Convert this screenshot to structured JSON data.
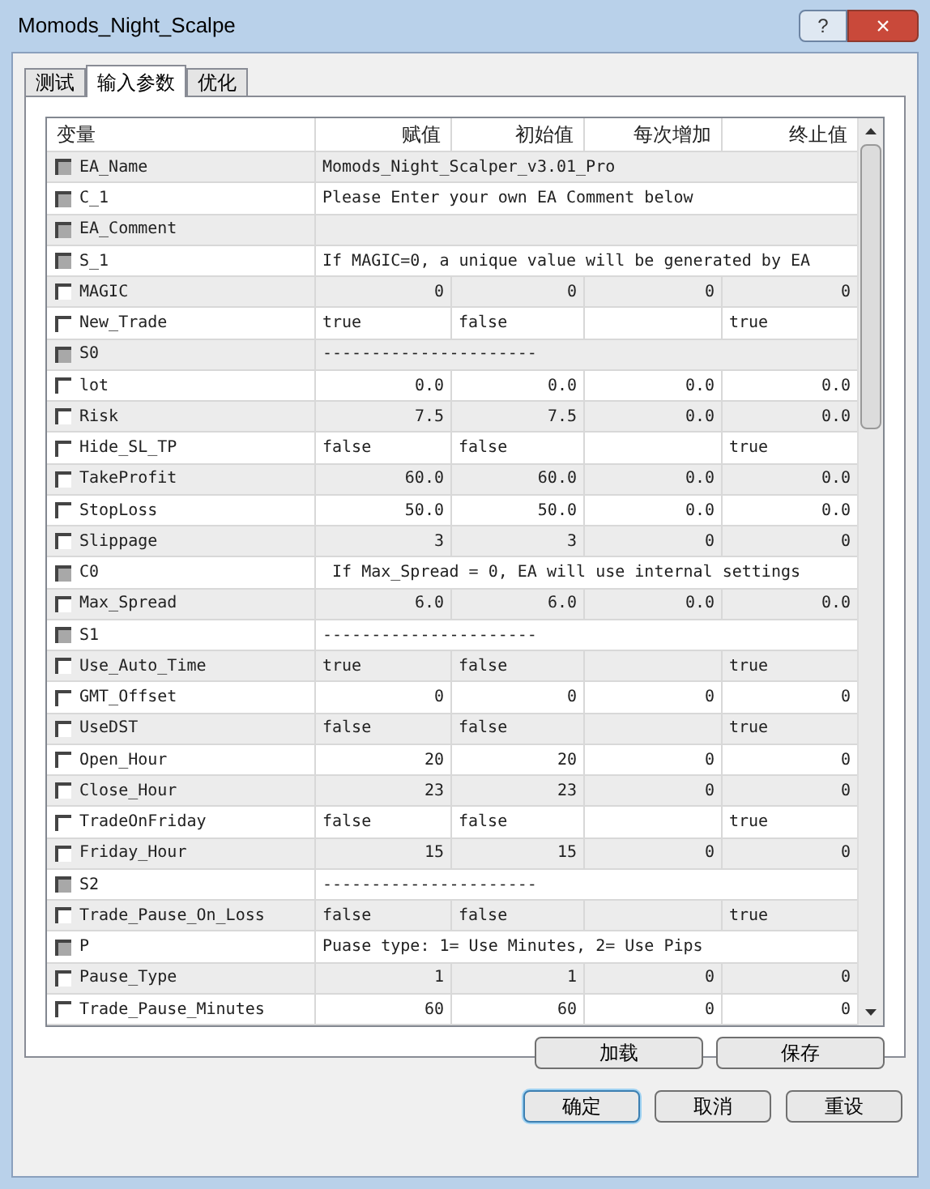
{
  "window": {
    "title": "Momods_Night_Scalpe",
    "help": "?",
    "close": "×"
  },
  "tabs": [
    {
      "label": "测试",
      "selected": false
    },
    {
      "label": "输入参数",
      "selected": true
    },
    {
      "label": "优化",
      "selected": false
    }
  ],
  "table": {
    "columns": [
      "变量",
      "赋值",
      "初始值",
      "每次增加",
      "终止值"
    ],
    "rows": [
      {
        "kind": "text",
        "disabled": true,
        "checked": false,
        "cells": [
          "EA_Name",
          "Momods_Night_Scalper_v3.01_Pro"
        ]
      },
      {
        "kind": "text",
        "disabled": true,
        "checked": false,
        "cells": [
          "C_1",
          "Please Enter your own EA Comment below"
        ]
      },
      {
        "kind": "text",
        "disabled": true,
        "checked": false,
        "cells": [
          "EA_Comment"
        ]
      },
      {
        "kind": "text",
        "disabled": true,
        "checked": false,
        "cells": [
          "S_1",
          "If MAGIC=0, a unique value will be generated by EA"
        ]
      },
      {
        "kind": "number",
        "disabled": false,
        "checked": false,
        "cells": [
          "MAGIC",
          "0",
          "0",
          "0",
          "0"
        ]
      },
      {
        "kind": "bool",
        "disabled": false,
        "checked": false,
        "cells": [
          "New_Trade",
          "true",
          "false",
          "",
          "true"
        ]
      },
      {
        "kind": "text",
        "disabled": true,
        "checked": false,
        "cells": [
          "S0",
          "----------------------"
        ]
      },
      {
        "kind": "number",
        "disabled": false,
        "checked": false,
        "cells": [
          "lot",
          "0.0",
          "0.0",
          "0.0",
          "0.0"
        ]
      },
      {
        "kind": "number",
        "disabled": false,
        "checked": false,
        "cells": [
          "Risk",
          "7.5",
          "7.5",
          "0.0",
          "0.0"
        ]
      },
      {
        "kind": "bool",
        "disabled": false,
        "checked": false,
        "cells": [
          "Hide_SL_TP",
          "false",
          "false",
          "",
          "true"
        ]
      },
      {
        "kind": "number",
        "disabled": false,
        "checked": false,
        "cells": [
          "TakeProfit",
          "60.0",
          "60.0",
          "0.0",
          "0.0"
        ]
      },
      {
        "kind": "number",
        "disabled": false,
        "checked": false,
        "cells": [
          "StopLoss",
          "50.0",
          "50.0",
          "0.0",
          "0.0"
        ]
      },
      {
        "kind": "number",
        "disabled": false,
        "checked": false,
        "cells": [
          "Slippage",
          "3",
          "3",
          "0",
          "0"
        ]
      },
      {
        "kind": "text",
        "disabled": true,
        "checked": false,
        "cells": [
          "C0",
          " If Max_Spread = 0, EA will use internal settings"
        ]
      },
      {
        "kind": "number",
        "disabled": false,
        "checked": false,
        "cells": [
          "Max_Spread",
          "6.0",
          "6.0",
          "0.0",
          "0.0"
        ]
      },
      {
        "kind": "text",
        "disabled": true,
        "checked": false,
        "cells": [
          "S1",
          "----------------------"
        ]
      },
      {
        "kind": "bool",
        "disabled": false,
        "checked": false,
        "cells": [
          "Use_Auto_Time",
          "true",
          "false",
          "",
          "true"
        ]
      },
      {
        "kind": "number",
        "disabled": false,
        "checked": false,
        "cells": [
          "GMT_Offset",
          "0",
          "0",
          "0",
          "0"
        ]
      },
      {
        "kind": "bool",
        "disabled": false,
        "checked": false,
        "cells": [
          "UseDST",
          "false",
          "false",
          "",
          "true"
        ]
      },
      {
        "kind": "number",
        "disabled": false,
        "checked": false,
        "cells": [
          "Open_Hour",
          "20",
          "20",
          "0",
          "0"
        ]
      },
      {
        "kind": "number",
        "disabled": false,
        "checked": false,
        "cells": [
          "Close_Hour",
          "23",
          "23",
          "0",
          "0"
        ]
      },
      {
        "kind": "bool",
        "disabled": false,
        "checked": false,
        "cells": [
          "TradeOnFriday",
          "false",
          "false",
          "",
          "true"
        ]
      },
      {
        "kind": "number",
        "disabled": false,
        "checked": false,
        "cells": [
          "Friday_Hour",
          "15",
          "15",
          "0",
          "0"
        ]
      },
      {
        "kind": "text",
        "disabled": true,
        "checked": false,
        "cells": [
          "S2",
          "----------------------"
        ]
      },
      {
        "kind": "bool",
        "disabled": false,
        "checked": false,
        "cells": [
          "Trade_Pause_On_Loss",
          "false",
          "false",
          "",
          "true"
        ]
      },
      {
        "kind": "text",
        "disabled": true,
        "checked": false,
        "cells": [
          "P",
          "Puase type: 1= Use Minutes, 2= Use Pips"
        ]
      },
      {
        "kind": "number",
        "disabled": false,
        "checked": false,
        "cells": [
          "Pause_Type",
          "1",
          "1",
          "0",
          "0"
        ]
      },
      {
        "kind": "number",
        "disabled": false,
        "checked": false,
        "cells": [
          "Trade_Pause_Minutes",
          "60",
          "60",
          "0",
          "0"
        ]
      }
    ]
  },
  "buttons_top": [
    "加载",
    "保存"
  ],
  "buttons_bottom": [
    {
      "label": "确定",
      "default": true
    },
    {
      "label": "取消",
      "default": false
    },
    {
      "label": "重设",
      "default": false
    }
  ]
}
